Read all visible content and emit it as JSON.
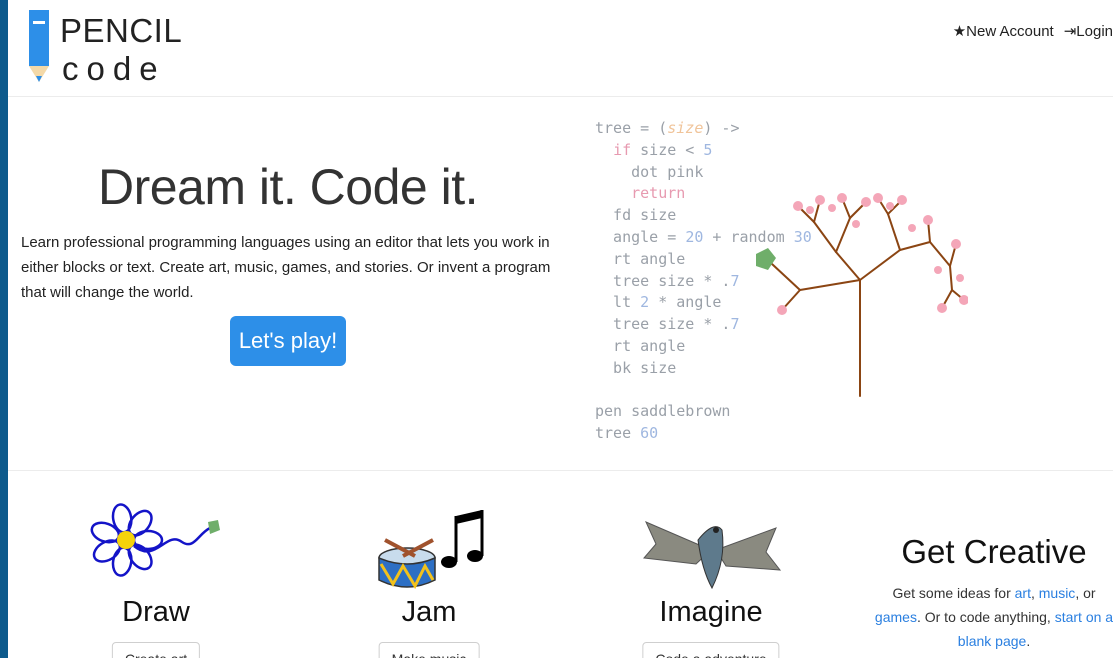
{
  "header": {
    "logo_top": "PENCIL",
    "logo_bottom": "code",
    "new_account": "New Account",
    "login": "Login"
  },
  "hero": {
    "title": "Dream it. Code it.",
    "description": "Learn professional programming languages using an editor that lets you work in either blocks or text. Create art, music, games, and stories. Or invent a program that will change the world.",
    "cta": "Let's play!"
  },
  "code_sample": [
    "tree = (size) ->",
    "  if size < 5",
    "    dot pink",
    "    return",
    "  fd size",
    "  angle = 20 + random 30",
    "  rt angle",
    "  tree size * .7",
    "  lt 2 * angle",
    "  tree size * .7",
    "  rt angle",
    "  bk size",
    "",
    "pen saddlebrown",
    "tree 60"
  ],
  "features": [
    {
      "title": "Draw",
      "button": "Create art"
    },
    {
      "title": "Jam",
      "button": "Make music"
    },
    {
      "title": "Imagine",
      "button": "Code a adventure"
    }
  ],
  "creative": {
    "title": "Get Creative",
    "text_1": "Get some ideas for ",
    "link_art": "art",
    "sep_1": ", ",
    "link_music": "music",
    "sep_2": ", or",
    "link_games": "games",
    "text_2": ". Or to code anything, ",
    "link_blank": "start on a blank page",
    "text_3": "."
  },
  "colors": {
    "frame": "#0d5a8c",
    "accent": "#2d8fe8",
    "link": "#2a7fe0",
    "tree_trunk": "#8b4513",
    "tree_leaf": "#f4a6b8"
  }
}
